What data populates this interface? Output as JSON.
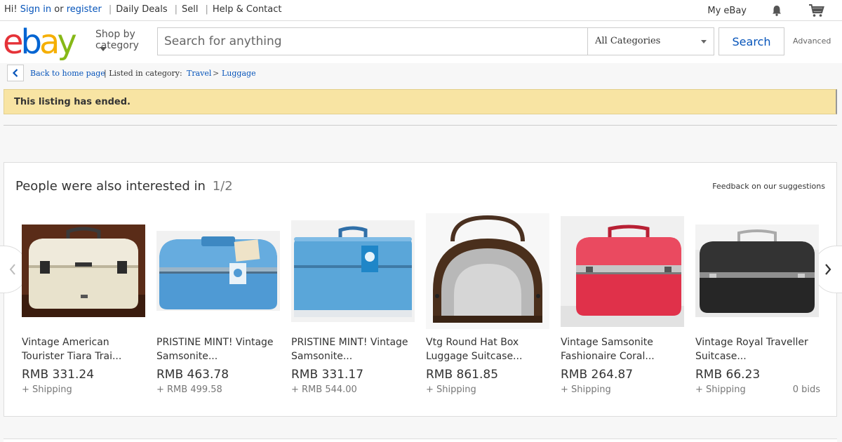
{
  "topbar": {
    "greeting": "Hi!",
    "sign_in": "Sign in",
    "or": "or",
    "register": "register",
    "links": [
      "Daily Deals",
      "Sell",
      "Help & Contact"
    ],
    "my_ebay": "My eBay",
    "bell_icon": "bell-icon",
    "cart_icon": "cart-icon"
  },
  "header": {
    "logo": {
      "e": "e",
      "b": "b",
      "a": "a",
      "y": "y"
    },
    "shop_by_line1": "Shop by",
    "shop_by_line2": "category",
    "search_placeholder": "Search for anything",
    "category": "All Categories",
    "search_button": "Search",
    "advanced": "Advanced"
  },
  "breadcrumb": {
    "back": "Back to home page",
    "listed_in": "| Listed in category:",
    "cat1": "Travel",
    "separator": ">",
    "cat2": "Luggage"
  },
  "banner": {
    "text": "This listing has ended."
  },
  "suggestions": {
    "title": "People were also interested in",
    "page": "1/2",
    "feedback": "Feedback on our suggestions",
    "items": [
      {
        "title": "Vintage American Tourister Tiara Trai...",
        "price": "RMB 331.24",
        "shipping": "+ Shipping",
        "bids": ""
      },
      {
        "title": "PRISTINE MINT! Vintage Samsonite...",
        "price": "RMB 463.78",
        "shipping": "+ RMB 499.58",
        "bids": ""
      },
      {
        "title": "PRISTINE MINT! Vintage Samsonite...",
        "price": "RMB 331.17",
        "shipping": "+ RMB 544.00",
        "bids": ""
      },
      {
        "title": "Vtg Round Hat Box Luggage Suitcase...",
        "price": "RMB 861.85",
        "shipping": "+ Shipping",
        "bids": ""
      },
      {
        "title": "Vintage Samsonite Fashionaire Coral...",
        "price": "RMB 264.87",
        "shipping": "+ Shipping",
        "bids": ""
      },
      {
        "title": "Vintage Royal Traveller Suitcase...",
        "price": "RMB 66.23",
        "shipping": "+ Shipping",
        "bids": "0 bids"
      }
    ]
  }
}
